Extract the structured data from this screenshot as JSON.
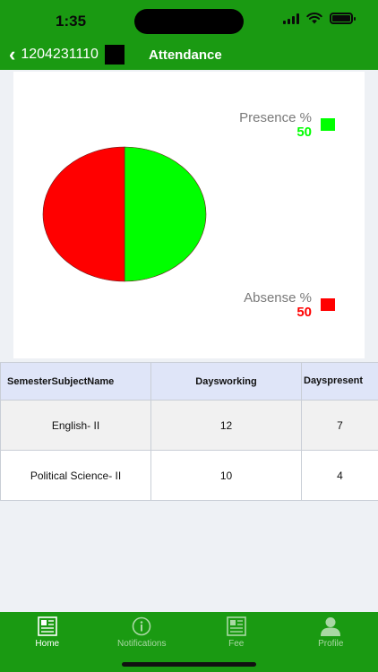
{
  "status_bar": {
    "time": "1:35"
  },
  "nav": {
    "roll_number": "1204231110",
    "title": "Attendance"
  },
  "chart_data": {
    "type": "pie",
    "series": [
      {
        "name": "Presence %",
        "value": 50,
        "color": "#00ff00"
      },
      {
        "name": "Absense %",
        "value": 50,
        "color": "#ff0000"
      }
    ],
    "legend_position": "right"
  },
  "table": {
    "headers": [
      "SemesterSubjectName",
      "Daysworking",
      "Dayspresent"
    ],
    "rows": [
      [
        "English- II",
        "12",
        "7"
      ],
      [
        "Political Science- II",
        "10",
        "4"
      ]
    ]
  },
  "tabs": [
    {
      "label": "Home",
      "icon": "document-icon",
      "active": true
    },
    {
      "label": "Notifications",
      "icon": "info-icon",
      "active": false
    },
    {
      "label": "Fee",
      "icon": "fee-document-icon",
      "active": false
    },
    {
      "label": "Profile",
      "icon": "person-icon",
      "active": false
    }
  ],
  "colors": {
    "primary": "#1a9a12",
    "present": "#00ff00",
    "absent": "#ff0000",
    "header_bg": "#dfe5f8"
  }
}
